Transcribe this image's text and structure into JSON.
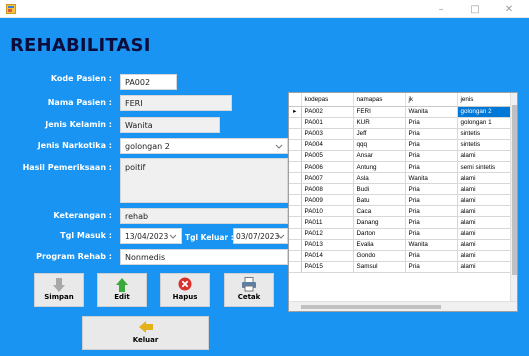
{
  "window": {
    "minimize_glyph": "–",
    "maximize_glyph": "□",
    "close_glyph": "✕"
  },
  "title": "REHABILITASI",
  "form": {
    "kode_pasien": {
      "label": "Kode Pasien :",
      "value": "PA002"
    },
    "nama_pasien": {
      "label": "Nama Pasien :",
      "value": "FERI"
    },
    "jenis_kelamin": {
      "label": "Jenis Kelamin :",
      "value": "Wanita"
    },
    "jenis_narkotika": {
      "label": "Jenis Narkotika :",
      "value": "golongan 2"
    },
    "hasil_pemeriksaan": {
      "label": "Hasil Pemeriksaan :",
      "value": "poitif"
    },
    "keterangan": {
      "label": "Keterangan :",
      "value": "rehab"
    },
    "tgl_masuk": {
      "label": "Tgl Masuk :",
      "value": "13/04/2023"
    },
    "tgl_keluar": {
      "label": "Tgl Keluar :",
      "value": "03/07/2023"
    },
    "program_rehab": {
      "label": "Program Rehab :",
      "value": "Nonmedis"
    }
  },
  "buttons": {
    "simpan": "Simpan",
    "edit": "Edit",
    "hapus": "Hapus",
    "cetak": "Cetak",
    "keluar": "Keluar"
  },
  "icons": {
    "app": "form-icon",
    "simpan": "arrow-down-icon",
    "edit": "arrow-up-icon",
    "hapus": "delete-x-icon",
    "cetak": "printer-icon",
    "keluar": "arrow-left-icon",
    "dropdown": "chevron-down-icon"
  },
  "colors": {
    "form_bg": "#1a94f2",
    "title": "#0d0d3d",
    "selected_cell": "#0078d7"
  },
  "table": {
    "columns": [
      "kodepas",
      "namapas",
      "jk",
      "jenis"
    ],
    "current_row_marker": "▸",
    "rows": [
      [
        "PA002",
        "FERI",
        "Wanita",
        "golongan 2"
      ],
      [
        "PA001",
        "KUR",
        "Pria",
        "golongan 1"
      ],
      [
        "PA003",
        "Jeff",
        "Pria",
        "sintetis"
      ],
      [
        "PA004",
        "qqq",
        "Pria",
        "sintetis"
      ],
      [
        "PA005",
        "Ansar",
        "Pria",
        "alami"
      ],
      [
        "PA006",
        "Antung",
        "Pria",
        "semi sintetis"
      ],
      [
        "PA007",
        "Asla",
        "Wanita",
        "alami"
      ],
      [
        "PA008",
        "Budi",
        "Pria",
        "alami"
      ],
      [
        "PA009",
        "Batu",
        "Pria",
        "alami"
      ],
      [
        "PA010",
        "Caca",
        "Pria",
        "alami"
      ],
      [
        "PA011",
        "Danang",
        "Pria",
        "alami"
      ],
      [
        "PA012",
        "Darton",
        "Pria",
        "alami"
      ],
      [
        "PA013",
        "Evalia",
        "Wanita",
        "alami"
      ],
      [
        "PA014",
        "Gondo",
        "Pria",
        "alami"
      ],
      [
        "PA015",
        "Samsul",
        "Pria",
        "alami"
      ]
    ]
  }
}
